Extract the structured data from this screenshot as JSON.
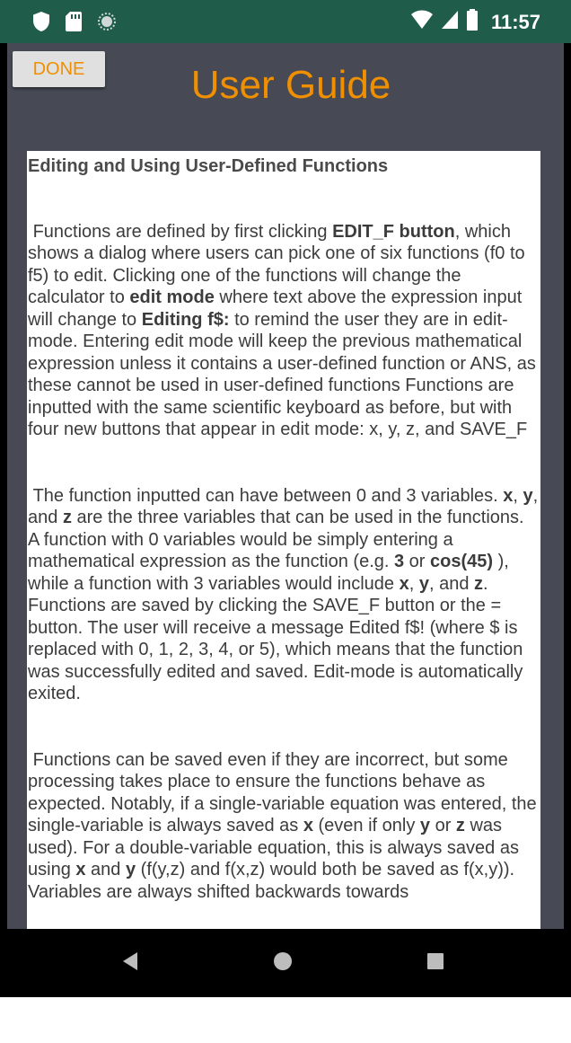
{
  "status_bar": {
    "time": "11:57",
    "icons_left": [
      "shield-icon",
      "sd-card-icon",
      "sync-circle-icon"
    ],
    "icons_right": [
      "wifi-icon",
      "cell-signal-icon",
      "battery-icon"
    ],
    "color": "#1f5c4a"
  },
  "header": {
    "done_label": "DONE",
    "title": "User Guide",
    "accent_color": "#f09000",
    "background_color": "#474a55"
  },
  "guide": {
    "heading": "Editing and Using User-Defined Functions",
    "paragraphs": [
      [
        {
          "t": " Functions are defined by first clicking "
        },
        {
          "t": "EDIT_F button",
          "b": true
        },
        {
          "t": ", which shows a dialog where users can pick one of six functions (f0 to f5) to edit. Clicking one of the functions will change the calculator to "
        },
        {
          "t": "edit mode",
          "b": true
        },
        {
          "t": " where text above the expression input will change to "
        },
        {
          "t": "Editing f$:",
          "b": true
        },
        {
          "t": " to remind the user they are in edit-mode. Entering edit mode will keep the previous mathematical expression unless it contains a user-defined function or ANS, as these cannot be used in user-defined functions Functions are inputted with the same scientific keyboard as before, but with four new buttons that appear in edit mode: x, y, z, and SAVE_F"
        }
      ],
      [
        {
          "t": " The function inputted can have between 0 and 3 variables. "
        },
        {
          "t": "x",
          "b": true
        },
        {
          "t": ", "
        },
        {
          "t": "y",
          "b": true
        },
        {
          "t": ", and "
        },
        {
          "t": "z",
          "b": true
        },
        {
          "t": " are the three variables that can be used in the functions. A function with 0 variables would be simply entering a mathematical expression as the function (e.g. "
        },
        {
          "t": "3",
          "b": true
        },
        {
          "t": " or "
        },
        {
          "t": "cos(45)",
          "b": true
        },
        {
          "t": " ), while a function with 3 variables would include "
        },
        {
          "t": "x",
          "b": true
        },
        {
          "t": ", "
        },
        {
          "t": "y",
          "b": true
        },
        {
          "t": ", and "
        },
        {
          "t": "z",
          "b": true
        },
        {
          "t": ". Functions are saved by clicking the SAVE_F button or the = button. The user will receive a message Edited f$! (where $ is replaced with 0, 1, 2, 3, 4, or 5), which means that the function was successfully edited and saved. Edit-mode is automatically exited."
        }
      ],
      [
        {
          "t": " Functions can be saved even if they are incorrect, but some processing takes place to ensure the functions behave as expected. Notably, if a single-variable equation was entered, the single-variable is always saved as "
        },
        {
          "t": "x",
          "b": true
        },
        {
          "t": " (even if only "
        },
        {
          "t": "y",
          "b": true
        },
        {
          "t": " or "
        },
        {
          "t": "z",
          "b": true
        },
        {
          "t": " was used). For a double-variable equation, this is always saved as using "
        },
        {
          "t": "x",
          "b": true
        },
        {
          "t": " and "
        },
        {
          "t": "y",
          "b": true
        },
        {
          "t": " (f(y,z) and f(x,z) would both be saved as f(x,y)). Variables are always shifted backwards towards"
        }
      ]
    ]
  },
  "navigation": {
    "buttons": [
      "back-icon",
      "home-icon",
      "recents-icon"
    ]
  }
}
